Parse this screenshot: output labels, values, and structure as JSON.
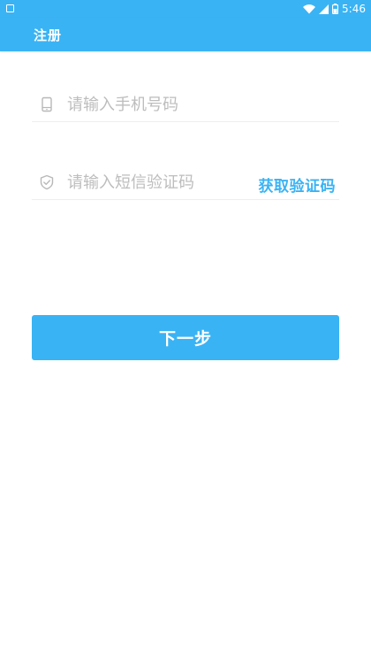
{
  "status_bar": {
    "time": "5:46",
    "icons": [
      "notification-icon",
      "wifi-icon",
      "signal-icon",
      "battery-icon"
    ]
  },
  "app_bar": {
    "title": "注册"
  },
  "form": {
    "phone": {
      "icon": "phone-icon",
      "placeholder": "请输入手机号码",
      "value": ""
    },
    "code": {
      "icon": "shield-check-icon",
      "placeholder": "请输入短信验证码",
      "value": "",
      "get_code_label": "获取验证码"
    },
    "next_label": "下一步"
  },
  "colors": {
    "primary": "#3ab3f4",
    "placeholder": "#bdbdbd",
    "divider": "#eeeeee",
    "icon": "#b8b8b8"
  }
}
